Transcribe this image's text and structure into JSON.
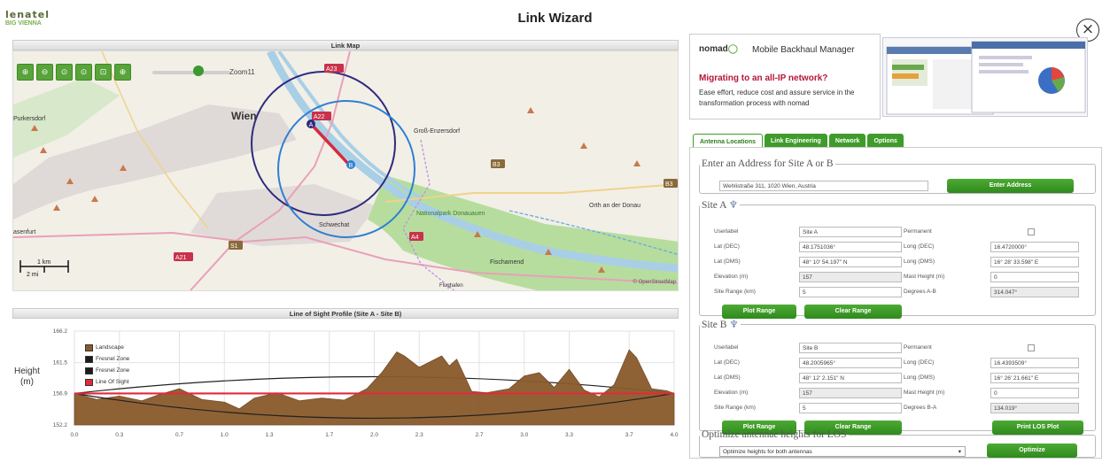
{
  "header": {
    "logo_top": "lenatel",
    "logo_bottom": "BIG VIENNA",
    "title": "Link Wizard",
    "close_symbol": "×"
  },
  "map": {
    "panel_title": "Link Map",
    "zoom_label": "Zoom11",
    "zoom_buttons": [
      "⊕",
      "⊖",
      "⊙",
      "⊙",
      "⊡",
      "⊕"
    ],
    "place_labels": [
      {
        "text": "Wien",
        "kind": "city"
      },
      {
        "text": "Groß-Enzersdorf",
        "kind": "town"
      },
      {
        "text": "Purkersdorf",
        "kind": "town"
      },
      {
        "text": "Schwechat",
        "kind": "town"
      },
      {
        "text": "Orth an der Donau",
        "kind": "town"
      },
      {
        "text": "Fischamend",
        "kind": "town"
      },
      {
        "text": "Nationalpark Donauauen",
        "kind": "park"
      },
      {
        "text": "Flughafen",
        "kind": "place"
      },
      {
        "text": "asenfurt",
        "kind": "town"
      }
    ],
    "road_labels": [
      "A23",
      "A22",
      "B3",
      "A4",
      "S1",
      "A21",
      "B3"
    ],
    "site_markers": [
      "A",
      "B"
    ],
    "scale": {
      "top": "1 km",
      "bottom": "2 mi"
    },
    "attribution": "© OpenStreetMap",
    "colors": {
      "water": "#a8cfe6",
      "park": "#b6dd9e",
      "land": "#f2efe7",
      "urban": "#d9d3d3",
      "circle_a": "#2e2a7d",
      "circle_b": "#2f7fd2",
      "link": "#d62a3c"
    }
  },
  "los": {
    "panel_title": "Line of Sight Profile (Site A - Site B)",
    "y_label_line1": "Height",
    "y_label_line2": "(m)",
    "legend": [
      {
        "label": "Landscape",
        "color": "#8a5a2b"
      },
      {
        "label": "Fresnel Zone",
        "color": "#1c1c1c"
      },
      {
        "label": "Fresnel Zone",
        "color": "#1c1c1c"
      },
      {
        "label": "Line Of Sight",
        "color": "#e02b3a"
      }
    ]
  },
  "chart_data": {
    "type": "area",
    "title": "Line of Sight Profile (Site A - Site B)",
    "xlabel": "",
    "ylabel": "Height (m)",
    "x_ticks": [
      "0.0",
      "0.3",
      "0.7",
      "1.0",
      "1.3",
      "1.7",
      "2.0",
      "2.3",
      "2.7",
      "3.0",
      "3.3",
      "3.7",
      "4.0"
    ],
    "y_ticks": [
      "152.2",
      "156.9",
      "161.5",
      "166.2"
    ],
    "ylim": [
      152.2,
      166.2
    ],
    "xlim": [
      0,
      4.0
    ],
    "los_height": 156.9,
    "fresnel_upper_peak": 159.4,
    "fresnel_lower_trough": 153.2,
    "series": [
      {
        "name": "Landscape",
        "x": [
          0,
          0.15,
          0.3,
          0.45,
          0.55,
          0.7,
          0.85,
          1.0,
          1.1,
          1.2,
          1.35,
          1.5,
          1.65,
          1.8,
          1.95,
          2.05,
          2.15,
          2.2,
          2.3,
          2.45,
          2.5,
          2.55,
          2.65,
          2.75,
          2.9,
          3.0,
          3.1,
          3.2,
          3.3,
          3.4,
          3.5,
          3.6,
          3.7,
          3.75,
          3.85,
          3.95,
          4.0
        ],
        "values": [
          156.9,
          156.0,
          156.5,
          155.8,
          156.6,
          157.6,
          156.0,
          155.6,
          154.6,
          156.2,
          157.0,
          155.8,
          156.2,
          155.9,
          157.6,
          160.0,
          163.1,
          162.5,
          160.8,
          162.5,
          161.0,
          162.0,
          157.2,
          157.0,
          157.6,
          159.5,
          160.0,
          157.8,
          160.5,
          157.4,
          156.4,
          158.2,
          163.4,
          162.2,
          157.6,
          157.3,
          156.9
        ]
      }
    ]
  },
  "ad": {
    "logo": "nomad",
    "product": "Mobile Backhaul Manager",
    "headline": "Migrating to an all-IP network?",
    "body": "Ease effort, reduce cost and assure service in the transformation process with nomad"
  },
  "tabs": [
    {
      "label": "Antenna Locations",
      "active": true
    },
    {
      "label": "Link Engineering",
      "active": false
    },
    {
      "label": "Network",
      "active": false
    },
    {
      "label": "Options",
      "active": false
    }
  ],
  "address": {
    "legend": "Enter an Address for Site A or B",
    "value": "Wehlistraße 311, 1020 Wien, Austria",
    "button": "Enter Address"
  },
  "siteA": {
    "legend": "Site A",
    "rows": [
      [
        "Userlabel",
        "Site A",
        "Permanent",
        ""
      ],
      [
        "Lat (DEC)",
        "48.1751036°",
        "Long (DEC)",
        "16.4720000°"
      ],
      [
        "Lat (DMS)",
        "48° 10' 54.197\" N",
        "Long (DMS)",
        "16° 28' 33.598\" E"
      ],
      [
        "Elevation (m)",
        "157",
        "Mast Height (m)",
        "0"
      ],
      [
        "Site Range (km)",
        "5",
        "Degrees A-B",
        "314.047°"
      ]
    ],
    "buttons": [
      "Plot Range",
      "Clear Range"
    ]
  },
  "siteB": {
    "legend": "Site B",
    "rows": [
      [
        "Userlabel",
        "Site B",
        "Permanent",
        ""
      ],
      [
        "Lat (DEC)",
        "48.2005965°",
        "Long (DEC)",
        "16.4393509°"
      ],
      [
        "Lat (DMS)",
        "48° 12' 2.151\" N",
        "Long (DMS)",
        "16° 26' 21.661\" E"
      ],
      [
        "Elevation (m)",
        "157",
        "Mast Height (m)",
        "0"
      ],
      [
        "Site Range (km)",
        "5",
        "Degrees B-A",
        "134.019°"
      ]
    ],
    "buttons": [
      "Plot Range",
      "Clear Range",
      "Print LOS Plot"
    ]
  },
  "optimize": {
    "legend": "Optimize antennae heights for LOS",
    "select": "Optimize heights for both antennas",
    "button": "Optimize"
  }
}
